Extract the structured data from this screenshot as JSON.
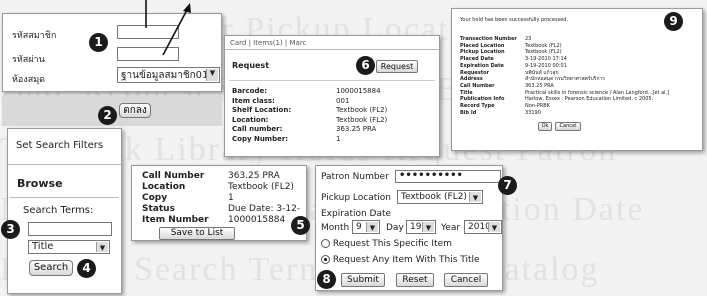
{
  "background_text": "Patron Number Pickup Location Expiration Date Request Search Terms Browse Catalog Textbook Library Holds Request Patron Number Pickup Location Expiration Date Request Search Terms Browse Catalog",
  "badges": [
    "1",
    "2",
    "3",
    "4",
    "5",
    "6",
    "7",
    "8",
    "9"
  ],
  "panel_login": {
    "label_member": "รหัสสมาชิก",
    "label_password": "รหัสผ่าน",
    "label_library": "ห้องสมุด",
    "library_select": "ฐานข้อมูลสมาชิก01",
    "submit_label": "ตกลง"
  },
  "panel_filters": {
    "set_filters": "Set Search Filters",
    "browse": "Browse",
    "search_terms_label": "Search Terms:",
    "search_type": "Title",
    "search_button": "Search"
  },
  "panel_item": {
    "rows": [
      {
        "k": "Call Number",
        "v": "363.25 PRA"
      },
      {
        "k": "Location",
        "v": "Textbook (FL2)"
      },
      {
        "k": "Copy",
        "v": "1"
      },
      {
        "k": "Status",
        "v": "Due Date: 3-12-"
      },
      {
        "k": "Item Number",
        "v": "1000015884"
      }
    ],
    "save_button": "Save to List"
  },
  "panel_card": {
    "tabs": "Card | Items(1) | Marc",
    "request_label": "Request",
    "request_button": "Request",
    "rows": [
      {
        "k": "Barcode:",
        "v": "1000015884"
      },
      {
        "k": "Item class:",
        "v": "001"
      },
      {
        "k": "Shelf Location:",
        "v": "Textbook (FL2)"
      },
      {
        "k": "Location:",
        "v": "Textbook (FL2)"
      },
      {
        "k": "Call number:",
        "v": "363.25 PRA"
      },
      {
        "k": "Copy Number:",
        "v": "1"
      }
    ]
  },
  "panel_hold": {
    "patron_label": "Patron Number",
    "patron_value": "••••••••••",
    "pickup_label": "Pickup Location",
    "pickup_value": "Textbook (FL2)",
    "expiration_label": "Expiration Date",
    "month_label": "Month",
    "month_value": "9",
    "day_label": "Day",
    "day_value": "19",
    "year_label": "Year",
    "year_value": "2010",
    "option_specific": "Request This Specific Item",
    "option_any": "Request Any Item With This Title",
    "submit": "Submit",
    "reset": "Reset",
    "cancel": "Cancel"
  },
  "panel_confirm": {
    "message": "Your hold has been successfully processed.",
    "rows": [
      {
        "k": "Transaction Number",
        "v": "23"
      },
      {
        "k": "Placed Location",
        "v": "Textbook (FL2)"
      },
      {
        "k": "Pickup Location",
        "v": "Textbook (FL2)"
      },
      {
        "k": "Placed Date",
        "v": "3-19-2010 17:14"
      },
      {
        "k": "Expiration Date",
        "v": "9-19-2010 00:01"
      },
      {
        "k": "Requestor",
        "v": "นพินันท์ แก้วสุก"
      },
      {
        "k": "Address",
        "v": "สำนักหอสมุด กรมวิทยาศาสตร์บริการ"
      },
      {
        "k": "Call Number",
        "v": "363.25 PRA"
      },
      {
        "k": "Title",
        "v": "Practical skills in forensic science / Alan Langford...[et al.]"
      },
      {
        "k": "Publication Info",
        "v": "Harlow, Essex : Pearson Education Limited, c 2005."
      },
      {
        "k": "Record Type",
        "v": "Non-PRBK"
      },
      {
        "k": "Bib Id",
        "v": "33190"
      }
    ],
    "ok": "Ok",
    "cancel": "Cancel"
  }
}
